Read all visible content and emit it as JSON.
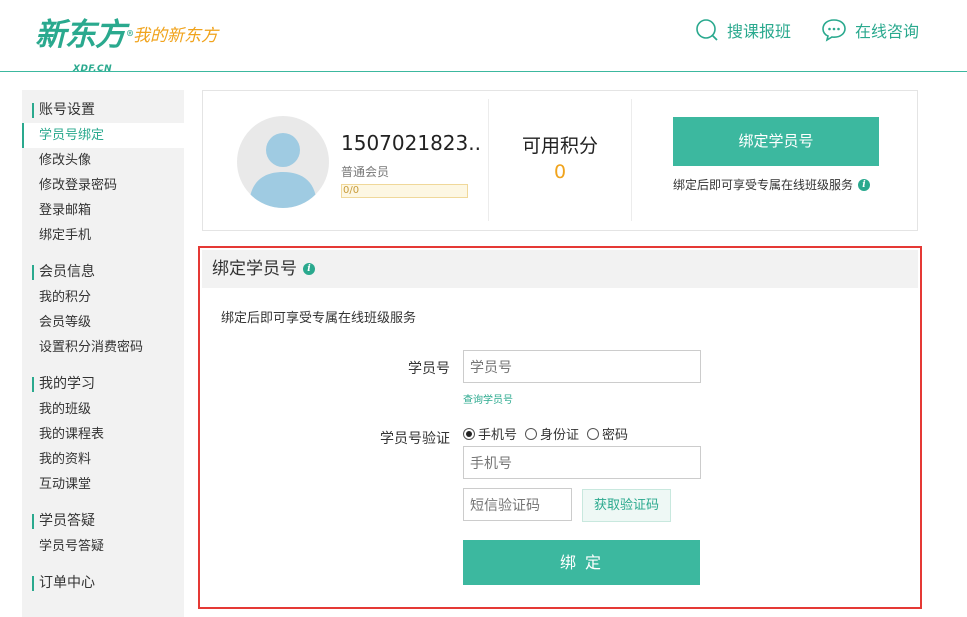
{
  "header": {
    "logo_main": "新东方",
    "logo_sub": "XDF.CN",
    "logo_reg": "®",
    "logo_slogan": "我的新东方",
    "links": [
      {
        "label": "搜课报班",
        "icon": "search-icon"
      },
      {
        "label": "在线咨询",
        "icon": "chat-icon"
      }
    ]
  },
  "sidebar": {
    "groups": [
      {
        "title": "账号设置",
        "items": [
          "学员号绑定",
          "修改头像",
          "修改登录密码",
          "登录邮箱",
          "绑定手机"
        ]
      },
      {
        "title": "会员信息",
        "items": [
          "我的积分",
          "会员等级",
          "设置积分消费密码"
        ]
      },
      {
        "title": "我的学习",
        "items": [
          "我的班级",
          "我的课程表",
          "我的资料",
          "互动课堂"
        ]
      },
      {
        "title": "学员答疑",
        "items": [
          "学员号答疑"
        ]
      },
      {
        "title": "订单中心",
        "items": []
      }
    ],
    "active": "学员号绑定"
  },
  "profile": {
    "username": "1507021823..",
    "level": "普通会员",
    "progress_text": "0/0",
    "points_label": "可用积分",
    "points_value": "0",
    "bind_button": "绑定学员号",
    "bind_hint": "绑定后即可享受专属在线班级服务"
  },
  "bind_panel": {
    "title": "绑定学员号",
    "description": "绑定后即可享受专属在线班级服务",
    "student_id_label": "学员号",
    "student_id_placeholder": "学员号",
    "lookup_link": "查询学员号",
    "verify_label": "学员号验证",
    "verify_options": [
      "手机号",
      "身份证",
      "密码"
    ],
    "verify_selected": "手机号",
    "phone_placeholder": "手机号",
    "sms_placeholder": "短信验证码",
    "get_code_button": "获取验证码",
    "submit_button": "绑 定"
  },
  "colors": {
    "brand": "#3cb89f",
    "accent": "#f0a31c",
    "highlight_border": "#e53935"
  }
}
